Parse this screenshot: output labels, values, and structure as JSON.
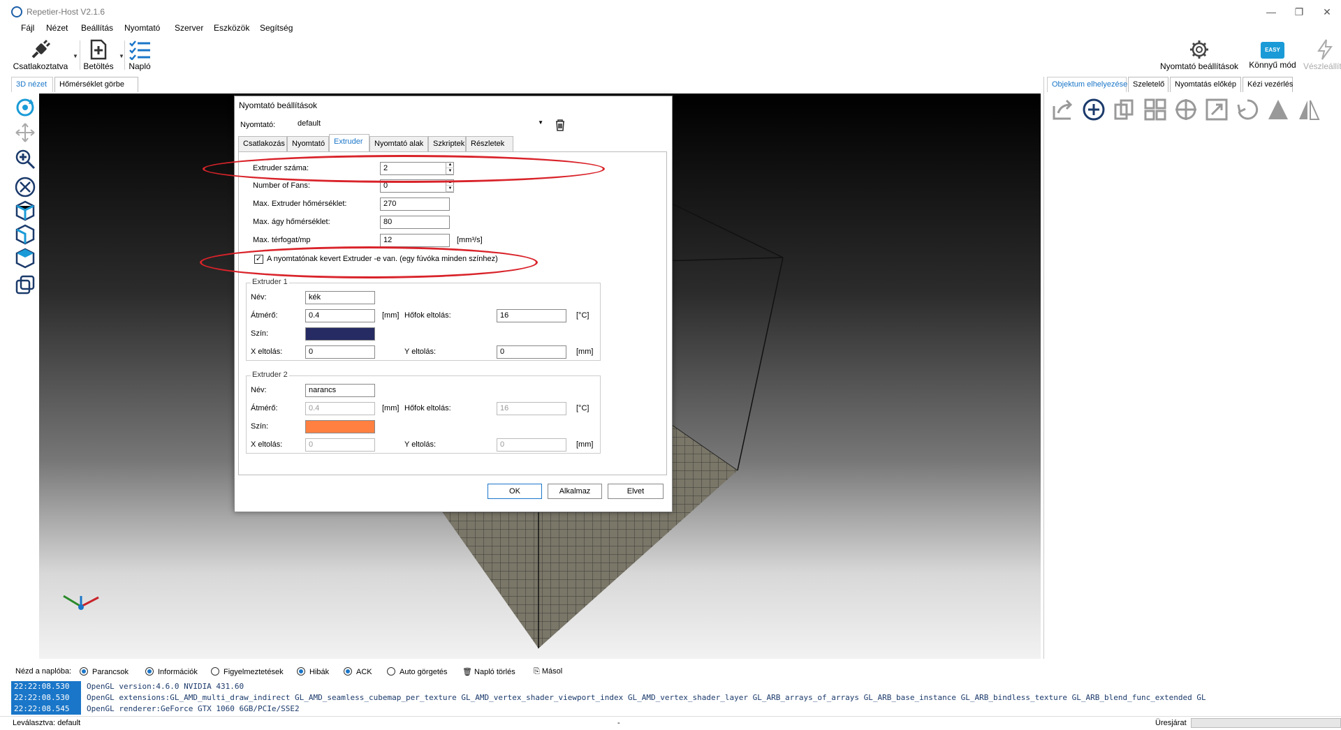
{
  "window": {
    "title": "Repetier-Host V2.1.6",
    "minimize": "—",
    "restore": "❐",
    "close": "✕"
  },
  "menu": [
    "Fájl",
    "Nézet",
    "Beállítás",
    "Nyomtató",
    "Szerver",
    "Eszközök",
    "Segítség"
  ],
  "toolbar": {
    "connect_label": "Csatlakoztatva",
    "load_label": "Betöltés",
    "log_label": "Napló",
    "printer_settings_label": "Nyomtató beállítások",
    "easy_mode_label": "Könnyű mód",
    "easy_badge": "EASY",
    "emergency_label": "Vészleállítás"
  },
  "left_tabs": [
    "3D nézet",
    "Hőmérséklet görbe"
  ],
  "right_tabs": [
    "Objektum elhelyezése",
    "Szeletelő",
    "Nyomtatás előkép",
    "Kézi vezérlés"
  ],
  "dialog": {
    "title": "Nyomtató beállítások",
    "printer_label": "Nyomtató:",
    "printer_value": "default",
    "tabs": [
      "Csatlakozás",
      "Nyomtató",
      "Extruder",
      "Nyomtató alak",
      "Szkriptek",
      "Részletek"
    ],
    "active_tab": "Extruder",
    "fields": {
      "extruder_count_label": "Extruder száma:",
      "extruder_count": "2",
      "fans_label": "Number of Fans:",
      "fans": "0",
      "max_extruder_temp_label": "Max. Extruder hőmérséklet:",
      "max_extruder_temp": "270",
      "max_bed_temp_label": "Max. ágy hőmérséklet:",
      "max_bed_temp": "80",
      "max_volume_label": "Max. térfogat/mp",
      "max_volume": "12",
      "max_volume_unit": "[mm³/s]",
      "mixing_label": "A nyomtatónak kevert Extruder -e van. (egy fúvóka minden színhez)",
      "mixing_checked": true
    },
    "extruders": [
      {
        "group": "Extruder 1",
        "name_label": "Név:",
        "name": "kék",
        "diameter_label": "Átmérő:",
        "diameter": "0.4",
        "diameter_unit": "[mm]",
        "temp_offset_label": "Hőfok eltolás:",
        "temp_offset": "16",
        "temp_unit": "[°C]",
        "color_label": "Szín:",
        "color": "#262b63",
        "x_offset_label": "X eltolás:",
        "x_offset": "0",
        "y_offset_label": "Y eltolás:",
        "y_offset": "0",
        "offset_unit": "[mm]",
        "disabled": false
      },
      {
        "group": "Extruder 2",
        "name_label": "Név:",
        "name": "narancs",
        "diameter_label": "Átmérő:",
        "diameter": "0.4",
        "diameter_unit": "[mm]",
        "temp_offset_label": "Hőfok eltolás:",
        "temp_offset": "16",
        "temp_unit": "[°C]",
        "color_label": "Szín:",
        "color": "#ff8040",
        "x_offset_label": "X eltolás:",
        "x_offset": "0",
        "y_offset_label": "Y eltolás:",
        "y_offset": "0",
        "offset_unit": "[mm]",
        "disabled": true
      }
    ],
    "buttons": {
      "ok": "OK",
      "apply": "Alkalmaz",
      "cancel": "Elvet"
    }
  },
  "logbar": {
    "label": "Nézd a naplóba:",
    "options": [
      {
        "label": "Parancsok",
        "on": true
      },
      {
        "label": "Információk",
        "on": true
      },
      {
        "label": "Figyelmeztetések",
        "on": false
      },
      {
        "label": "Hibák",
        "on": true
      },
      {
        "label": "ACK",
        "on": true
      },
      {
        "label": "Auto görgetés",
        "on": false
      }
    ],
    "clear_label": "Napló törlés",
    "copy_label": "Másol"
  },
  "log": [
    {
      "time": "22:22:08.530",
      "msg": "OpenGL version:4.6.0 NVIDIA 431.60"
    },
    {
      "time": "22:22:08.530",
      "msg": "OpenGL extensions:GL_AMD_multi_draw_indirect GL_AMD_seamless_cubemap_per_texture GL_AMD_vertex_shader_viewport_index GL_AMD_vertex_shader_layer GL_ARB_arrays_of_arrays GL_ARB_base_instance GL_ARB_bindless_texture GL_ARB_blend_func_extended GL"
    },
    {
      "time": "22:22:08.545",
      "msg": "OpenGL renderer:GeForce GTX 1060 6GB/PCIe/SSE2"
    }
  ],
  "status": {
    "left": "Leválasztva: default",
    "middle": "-",
    "right": "Üresjárat"
  },
  "colors": {
    "accent": "#1a76c8",
    "highlight_ellipse": "#d9232a"
  }
}
